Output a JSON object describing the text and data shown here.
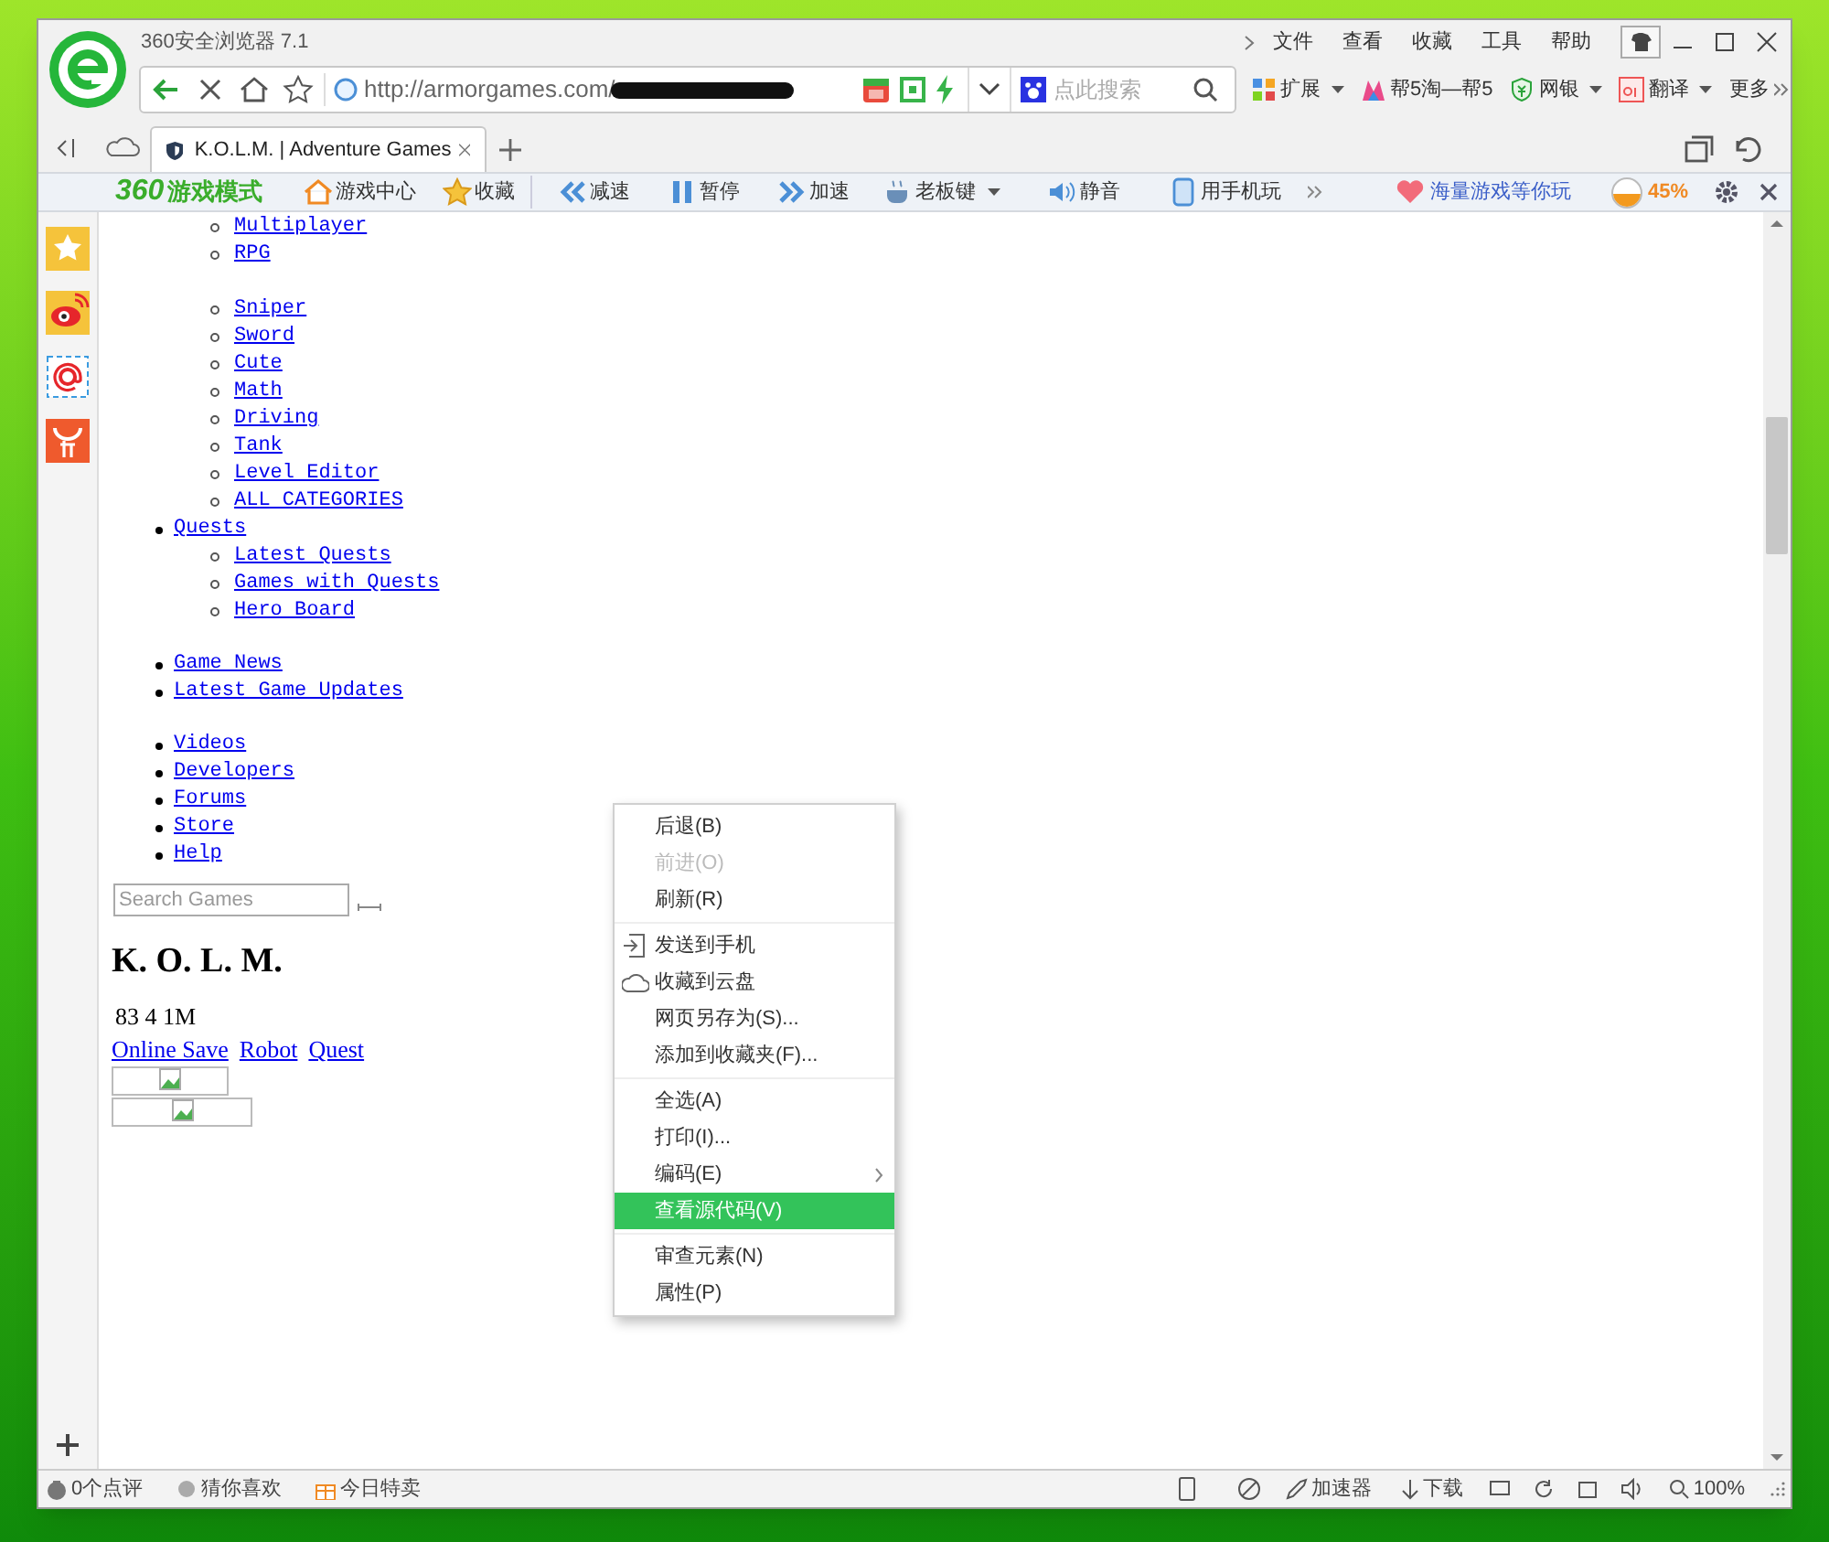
{
  "window": {
    "title": "360安全浏览器 7.1",
    "menu": [
      "文件",
      "查看",
      "收藏",
      "工具",
      "帮助"
    ]
  },
  "address_bar": {
    "url": "http://armorgames.com/",
    "search_placeholder": "点此搜索"
  },
  "toolbar": [
    {
      "label": "扩展",
      "dropdown": true
    },
    {
      "label": "帮5淘—帮5",
      "dropdown": false
    },
    {
      "label": "网银",
      "dropdown": true
    },
    {
      "label": "翻译",
      "dropdown": true
    },
    {
      "label": "更多",
      "dropdown": false
    }
  ],
  "tabs": [
    {
      "label": "K.O.L.M. | Adventure Games",
      "selected": true
    }
  ],
  "game_bar": {
    "brand_number": "360",
    "brand": "游戏模式",
    "items": [
      {
        "label": "游戏中心",
        "dropdown": false
      },
      {
        "label": "收藏",
        "dropdown": false
      },
      {
        "label": "减速",
        "dropdown": false
      },
      {
        "label": "暂停",
        "dropdown": false
      },
      {
        "label": "加速",
        "dropdown": false
      },
      {
        "label": "老板键",
        "dropdown": true
      },
      {
        "label": "静音",
        "dropdown": false
      },
      {
        "label": "用手机玩",
        "dropdown": false
      }
    ],
    "promo": "海量游戏等你玩",
    "percent": "45%"
  },
  "page": {
    "category_sublists": [
      [
        "Multiplayer",
        "RPG"
      ],
      [
        "Sniper",
        "Sword",
        "Cute",
        "Math",
        "Driving",
        "Tank",
        "Level Editor",
        "ALL CATEGORIES"
      ]
    ],
    "nav_groups": [
      [
        {
          "label": "Quests",
          "children": [
            "Latest Quests",
            "Games with Quests",
            "Hero Board"
          ]
        }
      ],
      [
        {
          "label": "Game News"
        },
        {
          "label": "Latest Game Updates"
        }
      ],
      [
        {
          "label": "Videos"
        },
        {
          "label": "Developers"
        },
        {
          "label": "Forums"
        },
        {
          "label": "Store"
        },
        {
          "label": "Help"
        }
      ]
    ],
    "search_placeholder": "Search Games",
    "heading": "K. O. L. M.",
    "stats": "83 4 1M",
    "links": [
      "Online Save",
      "Robot",
      "Quest"
    ]
  },
  "context_menu": [
    {
      "kind": "item",
      "label": "后退(B)",
      "disabled": false,
      "selected": false
    },
    {
      "kind": "item",
      "label": "前进(O)",
      "disabled": true,
      "selected": false
    },
    {
      "kind": "item",
      "label": "刷新(R)",
      "disabled": false,
      "selected": false
    },
    {
      "kind": "separator"
    },
    {
      "kind": "send",
      "label": "发送到手机",
      "disabled": false,
      "selected": false
    },
    {
      "kind": "cloud",
      "label": "收藏到云盘",
      "disabled": false,
      "selected": false
    },
    {
      "kind": "item",
      "label": "网页另存为(S)...",
      "disabled": false,
      "selected": false
    },
    {
      "kind": "item",
      "label": "添加到收藏夹(F)...",
      "disabled": false,
      "selected": false
    },
    {
      "kind": "separator"
    },
    {
      "kind": "item",
      "label": "全选(A)",
      "disabled": false,
      "selected": false
    },
    {
      "kind": "item",
      "label": "打印(I)...",
      "disabled": false,
      "selected": false
    },
    {
      "kind": "submenu",
      "label": "编码(E)",
      "disabled": false,
      "selected": false
    },
    {
      "kind": "item",
      "label": "查看源代码(V)",
      "disabled": false,
      "selected": true
    },
    {
      "kind": "separator"
    },
    {
      "kind": "item",
      "label": "审查元素(N)",
      "disabled": false,
      "selected": false
    },
    {
      "kind": "item",
      "label": "属性(P)",
      "disabled": false,
      "selected": false
    }
  ],
  "status_bar": {
    "left": [
      "0个点评",
      "猜你喜欢",
      "今日特卖"
    ],
    "accelerator": "加速器",
    "download": "下载",
    "zoom": "100%"
  }
}
